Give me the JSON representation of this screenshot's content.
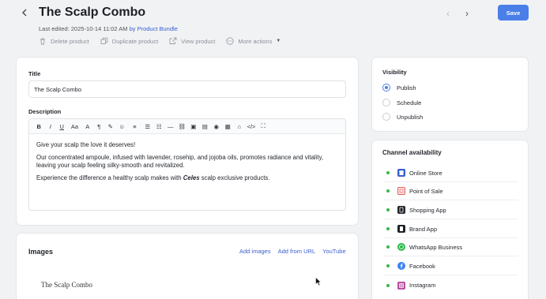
{
  "header": {
    "back_icon": "chevron-left-icon",
    "title": "The Scalp Combo",
    "last_edited_label": "Last edited:",
    "last_edited_date": "2025-10-14 11:02 AM",
    "last_edited_by": "by Product Bundle",
    "actions": [
      {
        "label": "Delete product",
        "icon": "trash-icon"
      },
      {
        "label": "Duplicate product",
        "icon": "copy-icon"
      },
      {
        "label": "View product",
        "icon": "external-link-icon"
      },
      {
        "label": "More actions",
        "icon": "more-icon"
      }
    ],
    "prev_arrow": "‹",
    "next_arrow": "›",
    "save_label": "Save"
  },
  "product": {
    "title_label": "Title",
    "title_value": "The Scalp Combo",
    "description_label": "Description",
    "description": {
      "p1": "Give your scalp the love it deserves!",
      "p2": "Our concentrated ampoule, infused with lavender, rosehip, and jojoba oils, promotes radiance and vitality, leaving your scalp feeling silky-smooth and revitalized.",
      "p3_before": "Experience the difference a healthy scalp makes with ",
      "p3_brand": "Celes",
      "p3_after": " scalp exclusive products."
    },
    "toolbar": [
      "B",
      "I",
      "U",
      "Aa",
      "A",
      "¶",
      "✎",
      "☺",
      "≡",
      "☰",
      "☷",
      "—",
      "⛓",
      "▣",
      "▤",
      "◉",
      "▦",
      "⌂",
      "</>",
      "⛶"
    ]
  },
  "images": {
    "title": "Images",
    "links": [
      "Add images",
      "Add from URL",
      "YouTube"
    ],
    "thumbnail_text": "The Scalp Combo"
  },
  "visibility": {
    "title": "Visibility",
    "options": [
      {
        "label": "Publish",
        "checked": true
      },
      {
        "label": "Schedule",
        "checked": false
      },
      {
        "label": "Unpublish",
        "checked": false
      }
    ]
  },
  "channels": {
    "title": "Channel availability",
    "items": [
      {
        "label": "Online Store",
        "icon": "store-icon",
        "color": "#3a5fcd"
      },
      {
        "label": "Point of Sale",
        "icon": "pos-icon",
        "color": "#e55b5b"
      },
      {
        "label": "Shopping App",
        "icon": "shopping-app-icon",
        "color": "#1f2329"
      },
      {
        "label": "Brand App",
        "icon": "brand-app-icon",
        "color": "#1f2329"
      },
      {
        "label": "WhatsApp Business",
        "icon": "whatsapp-icon",
        "color": "#2fb84e"
      },
      {
        "label": "Facebook",
        "icon": "facebook-icon",
        "color": "#3b82f6"
      },
      {
        "label": "Instagram",
        "icon": "instagram-icon",
        "color": "#b94ca0"
      }
    ]
  },
  "colors": {
    "accent": "#4a7ee8",
    "link": "#3a5fcd",
    "status_dot": "#3bb54a"
  }
}
